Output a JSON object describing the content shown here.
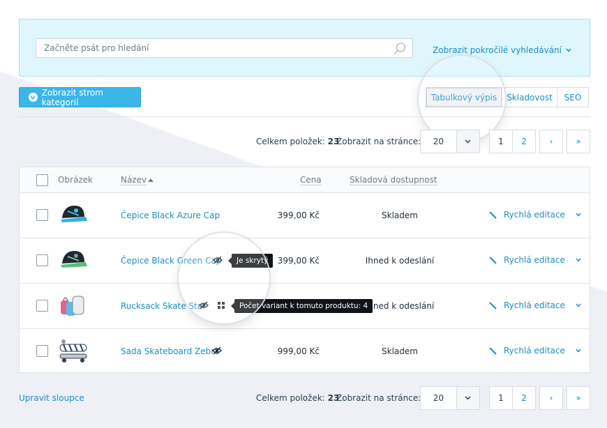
{
  "search": {
    "placeholder": "Začněte psát pro hledání",
    "advanced_label": "Zobrazit pokročilé vyhledávání"
  },
  "toolbar": {
    "tree_button_label": "Zobrazit strom kategorií",
    "view_tabs": [
      {
        "label": "Tabulkový výpis",
        "active": true
      },
      {
        "label": "Skladovost",
        "active": false
      },
      {
        "label": "SEO",
        "active": false
      }
    ]
  },
  "pager": {
    "total_label": "Celkem položek:",
    "total_value": "23",
    "per_page_label": "Zobrazit na stránce:",
    "per_page_value": "20",
    "pages": [
      "1",
      "2"
    ],
    "current_page": "1",
    "next_label": "›",
    "last_label": "»"
  },
  "table": {
    "headers": {
      "image": "Obrázek",
      "name": "Název",
      "price": "Cena",
      "stock": "Skladová dostupnost"
    },
    "rows": [
      {
        "name": "Čepice Black Azure Cap",
        "price": "399,00 Kč",
        "stock": "Skladem",
        "quick_edit": "Rychlá editace"
      },
      {
        "name": "Čepice Black Green Cap",
        "price": "399,00 Kč",
        "stock": "Ihned k odeslání",
        "quick_edit": "Rychlá editace",
        "tooltip": "Je skrytý"
      },
      {
        "name": "Rucksack Skate Star",
        "price": "",
        "stock": "Ihned k odeslání",
        "quick_edit": "Rychlá editace",
        "tooltip": "Počet variant k tomuto produktu: 4"
      },
      {
        "name": "Sada Skateboard Zebra",
        "price": "999,00 Kč",
        "stock": "Skladem",
        "quick_edit": "Rychlá editace"
      }
    ]
  },
  "footer": {
    "edit_columns_label": "Upravit sloupce"
  },
  "colors": {
    "accent": "#1a8dc4",
    "button": "#3bb6e8",
    "search_panel": "#dff6fd"
  }
}
